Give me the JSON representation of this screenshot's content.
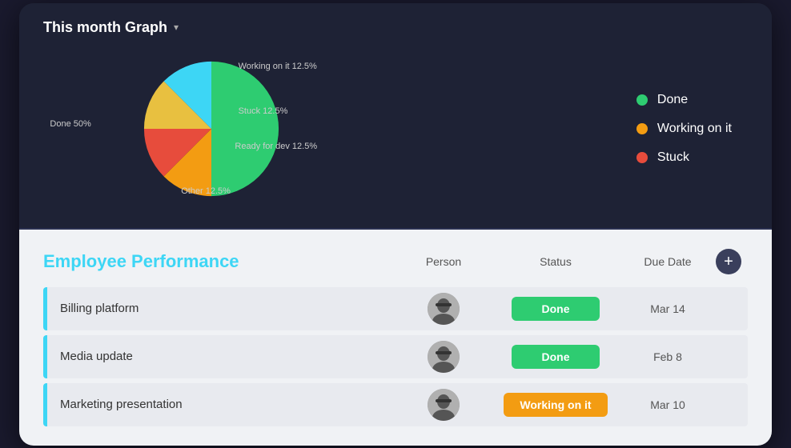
{
  "header": {
    "title_regular": "This month",
    "title_bold": "Graph",
    "dropdown_symbol": "▾"
  },
  "chart": {
    "slices": [
      {
        "label": "Done 50%",
        "percent": 50,
        "color": "#2ecc71",
        "startAngle": 0
      },
      {
        "label": "Working on it 12.5%",
        "percent": 12.5,
        "color": "#f39c12",
        "startAngle": 180
      },
      {
        "label": "Stuck 12.5%",
        "percent": 12.5,
        "color": "#e74c3c",
        "startAngle": 225
      },
      {
        "label": "Ready for dev 12.5%",
        "percent": 12.5,
        "color": "#e8c040",
        "startAngle": 270
      },
      {
        "label": "Other 12.5%",
        "percent": 12.5,
        "color": "#3dd6f5",
        "startAngle": 315
      }
    ],
    "pie_labels": [
      {
        "text": "Working on it 12.5%",
        "x": "62%",
        "y": "14%"
      },
      {
        "text": "Done 50%",
        "x": "10%",
        "y": "50%"
      },
      {
        "text": "Stuck 12.5%",
        "x": "62%",
        "y": "38%"
      },
      {
        "text": "Ready for dev 12.5%",
        "x": "62%",
        "y": "58%"
      },
      {
        "text": "Other 12.5%",
        "x": "45%",
        "y": "88%"
      }
    ],
    "legend": [
      {
        "label": "Done",
        "color": "#2ecc71"
      },
      {
        "label": "Working on it",
        "color": "#f39c12"
      },
      {
        "label": "Stuck",
        "color": "#e74c3c"
      }
    ]
  },
  "table": {
    "title": "Employee Performance",
    "columns": {
      "person": "Person",
      "status": "Status",
      "due_date": "Due Date"
    },
    "add_button_symbol": "+",
    "rows": [
      {
        "name": "Billing platform",
        "status": "Done",
        "status_type": "done",
        "due_date": "Mar 14"
      },
      {
        "name": "Media update",
        "status": "Done",
        "status_type": "done",
        "due_date": "Feb 8"
      },
      {
        "name": "Marketing presentation",
        "status": "Working on it",
        "status_type": "working",
        "due_date": "Mar 10"
      }
    ]
  }
}
